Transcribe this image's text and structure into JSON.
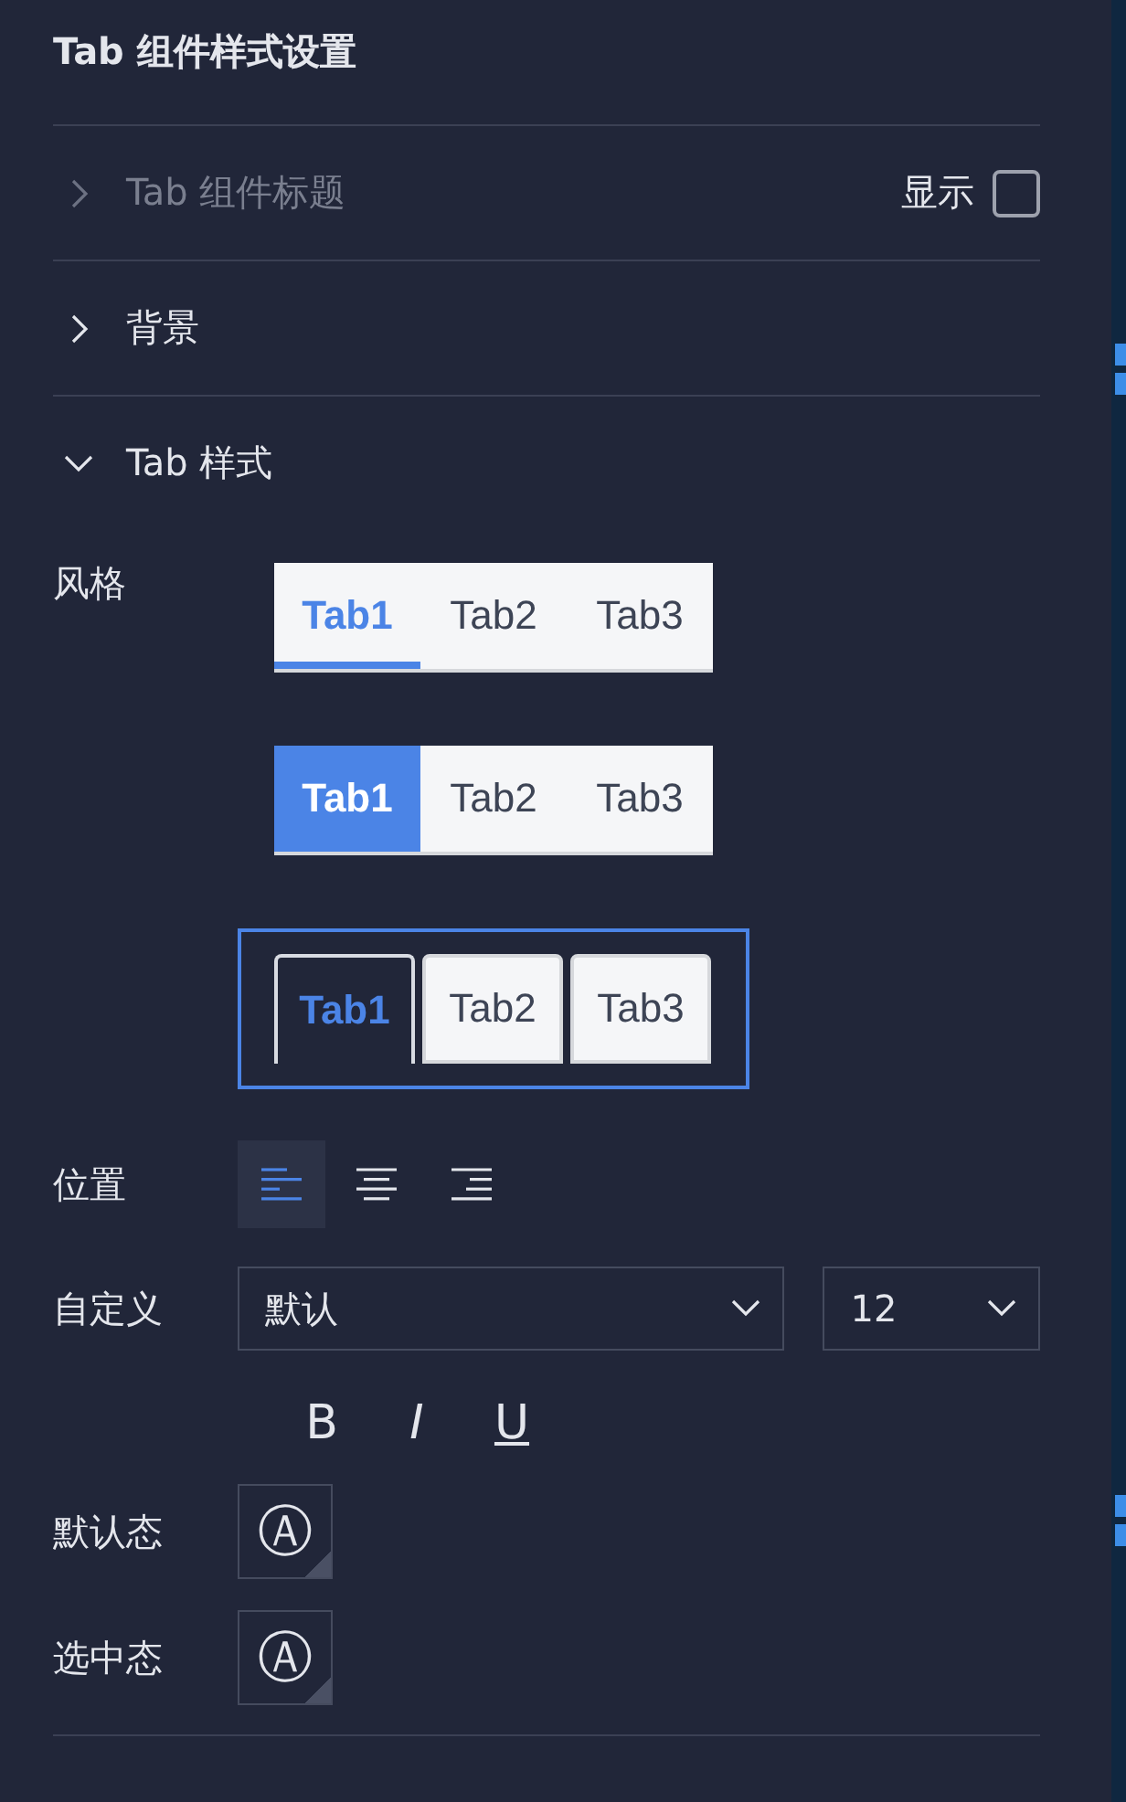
{
  "panel_title": "Tab 组件样式设置",
  "sections": [
    {
      "title": "Tab 组件标题",
      "expanded": false,
      "disabled": true,
      "toggle": {
        "label": "显示",
        "checked": false
      }
    },
    {
      "title": "背景",
      "expanded": false,
      "disabled": false
    },
    {
      "title": "Tab 样式",
      "expanded": true,
      "disabled": false
    }
  ],
  "style_label": "风格",
  "styles": [
    {
      "kind": "underline",
      "selected": false,
      "tabs": [
        {
          "label": "Tab1",
          "selected": true
        },
        {
          "label": "Tab2",
          "selected": false
        },
        {
          "label": "Tab3",
          "selected": false
        }
      ]
    },
    {
      "kind": "filled",
      "selected": false,
      "tabs": [
        {
          "label": "Tab1",
          "selected": true
        },
        {
          "label": "Tab2",
          "selected": false
        },
        {
          "label": "Tab3",
          "selected": false
        }
      ]
    },
    {
      "kind": "card",
      "selected": true,
      "tabs": [
        {
          "label": "Tab1",
          "selected": true
        },
        {
          "label": "Tab2",
          "selected": false
        },
        {
          "label": "Tab3",
          "selected": false
        }
      ]
    }
  ],
  "position_label": "位置",
  "alignments": [
    {
      "kind": "left",
      "selected": true
    },
    {
      "kind": "center",
      "selected": false
    },
    {
      "kind": "right",
      "selected": false
    }
  ],
  "custom_label": "自定义",
  "font_select": {
    "value": "默认"
  },
  "size_select": {
    "value": "12"
  },
  "format_buttons": [
    {
      "kind": "bold",
      "glyph": "B",
      "selected": false
    },
    {
      "kind": "italic",
      "glyph": "I",
      "selected": false
    },
    {
      "kind": "underline",
      "glyph": "U",
      "selected": false
    }
  ],
  "color_states": [
    {
      "label": "默认态",
      "glyph": "Ⓐ"
    },
    {
      "label": "选中态",
      "glyph": "Ⓐ"
    }
  ]
}
